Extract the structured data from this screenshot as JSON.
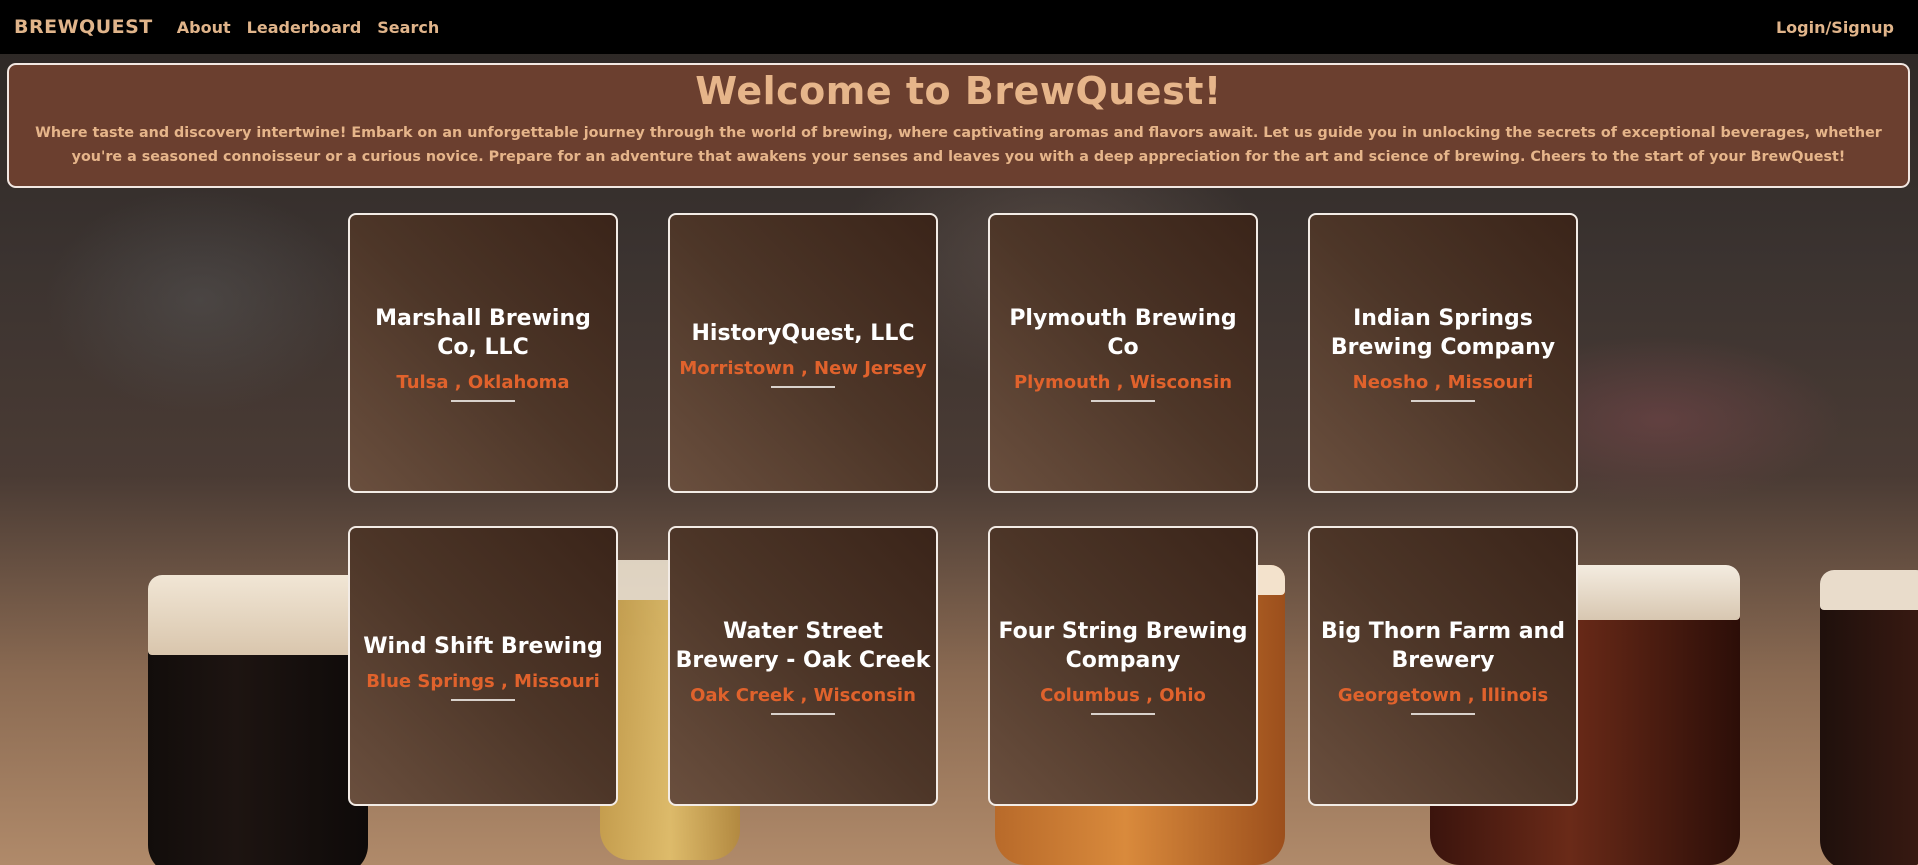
{
  "nav": {
    "brand": "BREWQUEST",
    "links": [
      "About",
      "Leaderboard",
      "Search"
    ],
    "login": "Login/Signup"
  },
  "welcome": {
    "title": "Welcome to BrewQuest!",
    "text": "Where taste and discovery intertwine! Embark on an unforgettable journey through the world of brewing, where captivating aromas and flavors await. Let us guide you in unlocking the secrets of exceptional beverages, whether you're a seasoned connoisseur or a curious novice. Prepare for an adventure that awakens your senses and leaves you with a deep appreciation for the art and science of brewing. Cheers to the start of your BrewQuest!"
  },
  "breweries": [
    {
      "name": "Marshall Brewing Co, LLC",
      "location": "Tulsa , Oklahoma"
    },
    {
      "name": "HistoryQuest, LLC",
      "location": "Morristown , New Jersey"
    },
    {
      "name": "Plymouth Brewing Co",
      "location": "Plymouth , Wisconsin"
    },
    {
      "name": "Indian Springs Brewing Company",
      "location": "Neosho , Missouri"
    },
    {
      "name": "Wind Shift Brewing",
      "location": "Blue Springs , Missouri"
    },
    {
      "name": "Water Street Brewery - Oak Creek",
      "location": "Oak Creek , Wisconsin"
    },
    {
      "name": "Four String Brewing Company",
      "location": "Columbus , Ohio"
    },
    {
      "name": "Big Thorn Farm and Brewery",
      "location": "Georgetown , Illinois"
    }
  ],
  "colors": {
    "nav_background": "#000000",
    "accent_text": "#e0b48a",
    "banner_background": "#6b3f2f",
    "card_location": "#e0622c",
    "card_border": "#f3ece6"
  }
}
